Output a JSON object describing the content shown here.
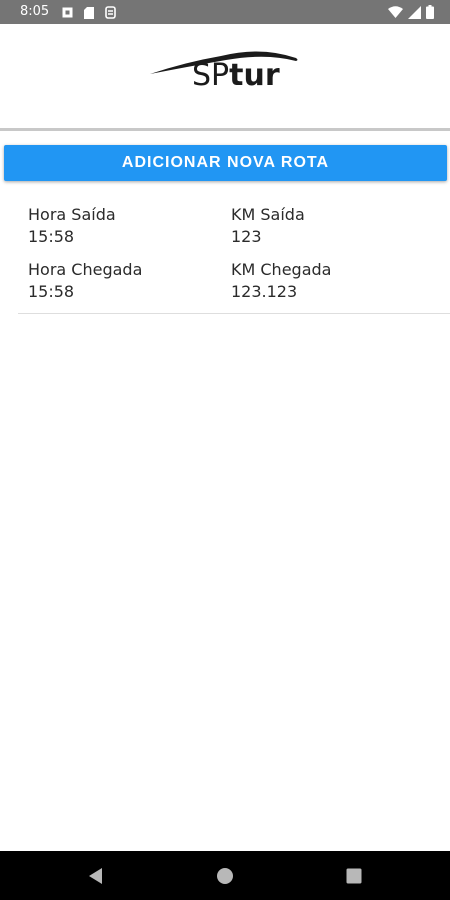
{
  "status_bar": {
    "time": "8:05",
    "left_icons": [
      "notification-square-icon",
      "sd-card-icon",
      "sync-badge-icon"
    ],
    "right_icons": [
      "wifi-icon",
      "cell-signal-icon",
      "battery-icon"
    ],
    "background": "#757575"
  },
  "logo": {
    "text_sp": "SP",
    "text_tur": "tur"
  },
  "actions": {
    "add_route_label": "ADICIONAR NOVA ROTA",
    "accent_color": "#2196f3"
  },
  "routes": [
    {
      "hora_saida_label": "Hora Saída",
      "hora_saida": "15:58",
      "km_saida_label": "KM Saída",
      "km_saida": "123",
      "hora_chegada_label": "Hora Chegada",
      "hora_chegada": "15:58",
      "km_chegada_label": "KM Chegada",
      "km_chegada": "123.123"
    }
  ],
  "nav_bar": {
    "buttons": [
      "back-icon",
      "home-icon",
      "recents-icon"
    ]
  }
}
